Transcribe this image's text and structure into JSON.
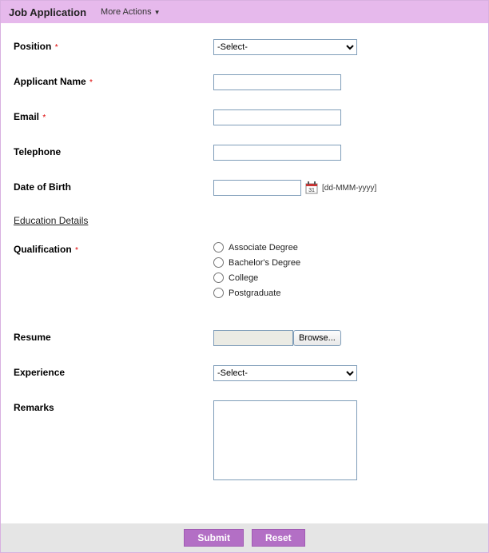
{
  "header": {
    "title": "Job Application",
    "more_actions": "More Actions"
  },
  "fields": {
    "position": {
      "label": "Position",
      "required": true,
      "placeholder": "-Select-"
    },
    "applicant_name": {
      "label": "Applicant Name",
      "required": true
    },
    "email": {
      "label": "Email",
      "required": true
    },
    "telephone": {
      "label": "Telephone",
      "required": false
    },
    "dob": {
      "label": "Date of Birth",
      "required": false,
      "hint": "[dd-MMM-yyyy]"
    },
    "qualification": {
      "label": "Qualification",
      "required": true,
      "options": [
        "Associate Degree",
        "Bachelor's Degree",
        "College",
        "Postgraduate"
      ]
    },
    "resume": {
      "label": "Resume",
      "browse": "Browse..."
    },
    "experience": {
      "label": "Experience",
      "placeholder": "-Select-"
    },
    "remarks": {
      "label": "Remarks"
    }
  },
  "section_education": "Education Details",
  "buttons": {
    "submit": "Submit",
    "reset": "Reset"
  },
  "required_mark": "*"
}
